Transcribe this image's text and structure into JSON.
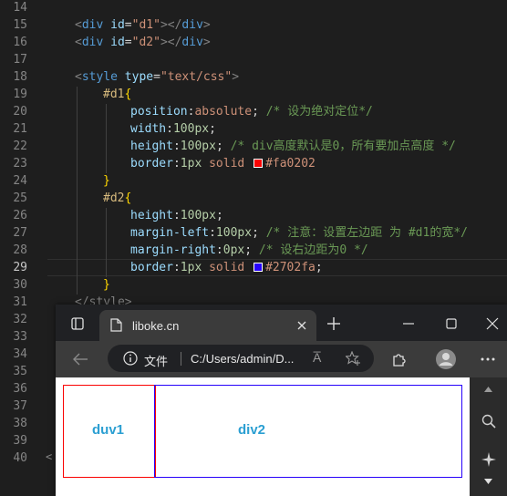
{
  "editor": {
    "line_numbers": [
      "14",
      "15",
      "16",
      "17",
      "18",
      "19",
      "20",
      "21",
      "22",
      "23",
      "24",
      "25",
      "26",
      "27",
      "28",
      "29",
      "30",
      "31",
      "32",
      "33",
      "34",
      "35",
      "36",
      "37",
      "38",
      "39",
      "40"
    ],
    "current_line": "29",
    "lines": {
      "l15": {
        "open": "<",
        "tag": "div",
        "attr": "id",
        "eq": "=",
        "str": "\"d1\"",
        "close": "></",
        "tag2": "div",
        "end": ">"
      },
      "l16": {
        "open": "<",
        "tag": "div",
        "attr": "id",
        "eq": "=",
        "str": "\"d2\"",
        "close": "></",
        "tag2": "div",
        "end": ">"
      },
      "l18": {
        "open": "<",
        "tag": "style",
        "attr": "type",
        "eq": "=",
        "str": "\"text/css\"",
        "end": ">"
      },
      "l19": {
        "selector": "#d1",
        "brace": "{"
      },
      "l20": {
        "prop": "position",
        "colon": ":",
        "value": "absolute",
        "semi": ";",
        "comment": "/* 设为绝对定位*/"
      },
      "l21": {
        "prop": "width",
        "colon": ":",
        "value": "100px",
        "semi": ";"
      },
      "l22": {
        "prop": "height",
        "colon": ":",
        "value": "100px",
        "semi": ";",
        "comment": "/* div高度默认是0，所有要加点高度 */"
      },
      "l23": {
        "prop": "border",
        "colon": ":",
        "v1": "1px",
        "v2": "solid",
        "color": "#fa0202"
      },
      "l24": {
        "brace": "}"
      },
      "l25": {
        "selector": "#d2",
        "brace": "{"
      },
      "l26": {
        "prop": "height",
        "colon": ":",
        "value": "100px",
        "semi": ";"
      },
      "l27": {
        "prop": "margin-left",
        "colon": ":",
        "value": "100px",
        "semi": ";",
        "comment": "/* 注意：设置左边距 为 #d1的宽*/"
      },
      "l28": {
        "prop": "margin-right",
        "colon": ":",
        "value": "0px",
        "semi": ";",
        "comment": "/* 设右边距为0 */"
      },
      "l29": {
        "prop": "border",
        "colon": ":",
        "v1": "1px",
        "v2": "solid",
        "color": "#2702fa",
        "semi": ";"
      },
      "l30": {
        "brace": "}"
      },
      "l31": {
        "text": "</style>"
      }
    },
    "fold_marker": "<"
  },
  "browser": {
    "tab_title": "liboke.cn",
    "url_label": "文件",
    "url_text": "C:/Users/admin/D...",
    "read_aloud": "A̅",
    "page": {
      "d1_label": "duv1",
      "d2_label": "div2",
      "d1_border_color": "#fa0202",
      "d2_border_color": "#2702fa",
      "label_color": "#2b9fd2"
    },
    "icons": [
      "tab-actions-icon",
      "page-icon",
      "close-tab-icon",
      "new-tab-icon",
      "minimize-icon",
      "maximize-icon",
      "close-window-icon",
      "back-icon",
      "info-icon",
      "read-aloud-icon",
      "favorites-add-icon",
      "extensions-icon",
      "profile-icon",
      "more-icon",
      "scroll-up-icon",
      "search-icon",
      "copilot-icon",
      "scroll-down-icon"
    ]
  }
}
